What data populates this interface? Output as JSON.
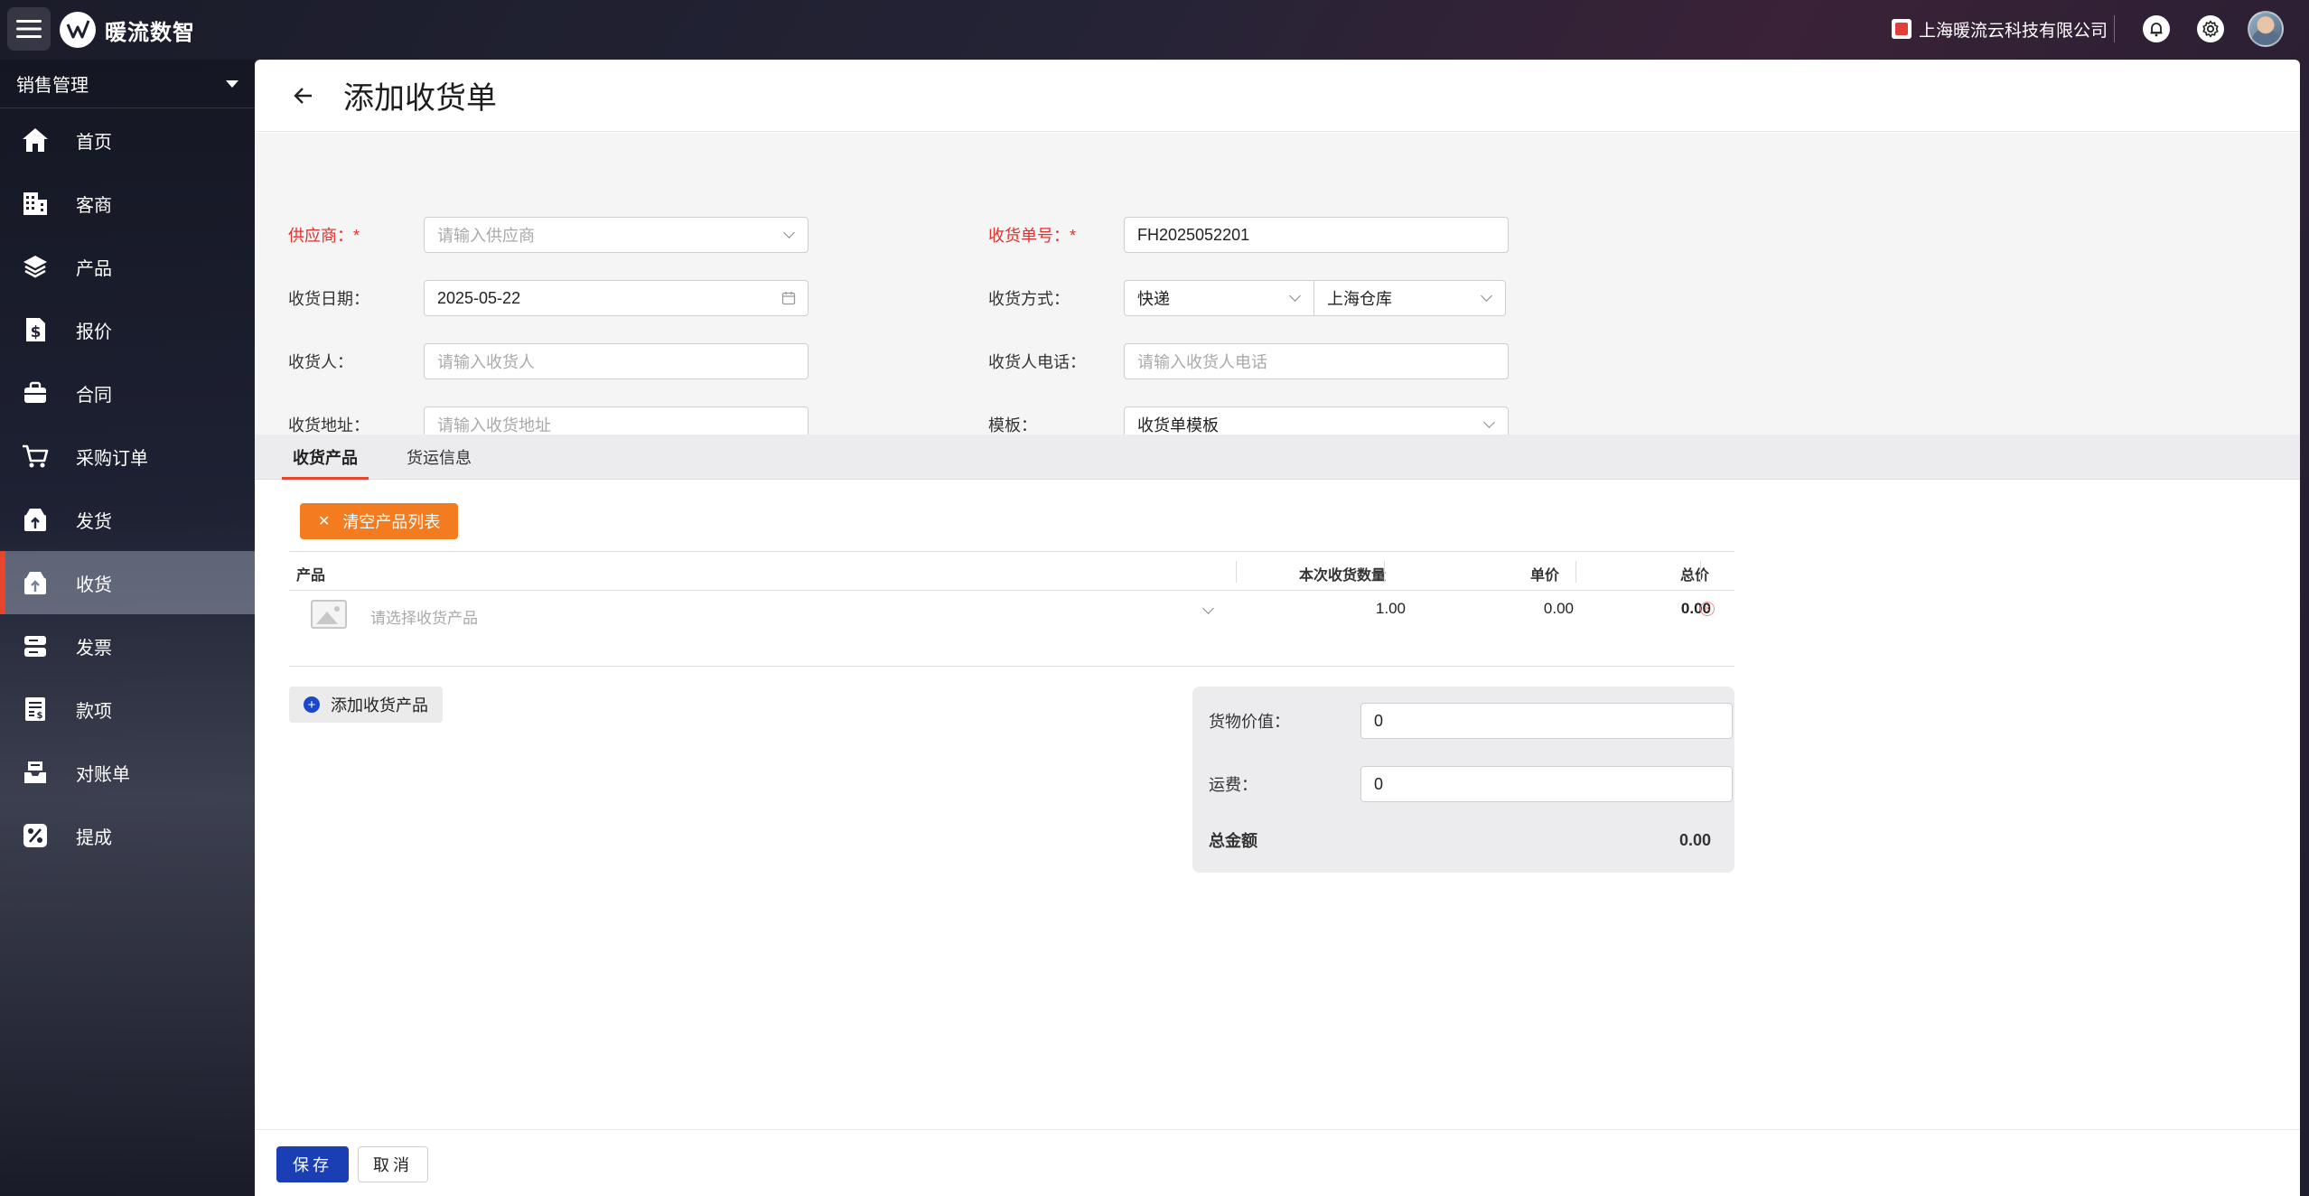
{
  "app": {
    "brand": "暖流数智",
    "company": "上海暖流云科技有限公司"
  },
  "sidebar": {
    "module": "销售管理",
    "items": [
      {
        "label": "首页",
        "icon": "home-icon",
        "active": false
      },
      {
        "label": "客商",
        "icon": "building-icon",
        "active": false
      },
      {
        "label": "产品",
        "icon": "layers-icon",
        "active": false
      },
      {
        "label": "报价",
        "icon": "quote-icon",
        "active": false
      },
      {
        "label": "合同",
        "icon": "contract-icon",
        "active": false
      },
      {
        "label": "采购订单",
        "icon": "cart-icon",
        "active": false
      },
      {
        "label": "发货",
        "icon": "shipping-icon",
        "active": false
      },
      {
        "label": "收货",
        "icon": "receiving-icon",
        "active": true
      },
      {
        "label": "发票",
        "icon": "invoice-icon",
        "active": false
      },
      {
        "label": "款项",
        "icon": "payment-icon",
        "active": false
      },
      {
        "label": "对账单",
        "icon": "statement-icon",
        "active": false
      },
      {
        "label": "提成",
        "icon": "percent-icon",
        "active": false
      }
    ]
  },
  "page": {
    "title": "添加收货单"
  },
  "form": {
    "supplier": {
      "label": "供应商：*",
      "placeholder": "请输入供应商",
      "value": ""
    },
    "receipt_no": {
      "label": "收货单号：*",
      "value": "FH2025052201"
    },
    "receipt_date": {
      "label": "收货日期：",
      "value": "2025-05-22"
    },
    "method": {
      "label": "收货方式：",
      "value": "快递",
      "warehouse": "上海仓库"
    },
    "receiver": {
      "label": "收货人：",
      "placeholder": "请输入收货人",
      "value": ""
    },
    "receiver_phone": {
      "label": "收货人电话：",
      "placeholder": "请输入收货人电话",
      "value": ""
    },
    "address": {
      "label": "收货地址：",
      "placeholder": "请输入收货地址",
      "value": ""
    },
    "template": {
      "label": "模板：",
      "value": "收货单模板"
    }
  },
  "tabs": [
    {
      "label": "收货产品",
      "active": true
    },
    {
      "label": "货运信息",
      "active": false
    }
  ],
  "products": {
    "clear_label": "清空产品列表",
    "columns": {
      "product": "产品",
      "quantity": "本次收货数量",
      "unit_price": "单价",
      "total": "总价"
    },
    "rows": [
      {
        "product_placeholder": "请选择收货产品",
        "quantity": "1.00",
        "unit_price": "0.00",
        "total": "0.00"
      }
    ],
    "add_label": "添加收货产品"
  },
  "summary": {
    "goods_value_label": "货物价值：",
    "goods_value": "0",
    "freight_label": "运费：",
    "freight": "0",
    "total_label": "总金额",
    "total": "0.00"
  },
  "footer": {
    "save": "保存",
    "cancel": "取消"
  },
  "colors": {
    "accent": "#e8452e",
    "primary": "#1a3fb4",
    "orange": "#f47c20",
    "required": "#e1312e"
  }
}
